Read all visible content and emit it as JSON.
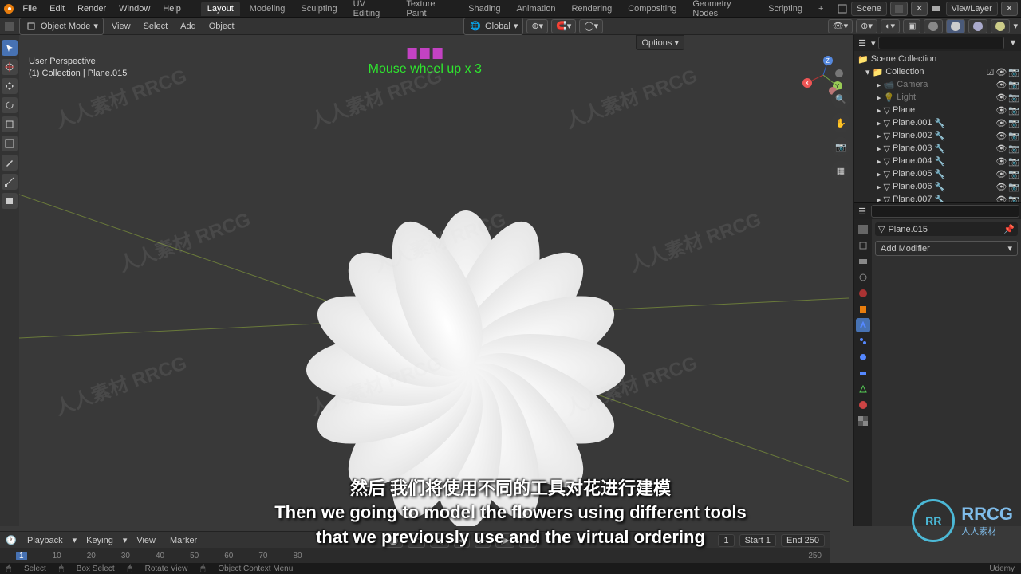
{
  "topbar1": {
    "logo": "blender-icon",
    "menus": [
      "File",
      "Edit",
      "Render",
      "Window",
      "Help"
    ],
    "tabs": [
      "Layout",
      "Modeling",
      "Sculpting",
      "UV Editing",
      "Texture Paint",
      "Shading",
      "Animation",
      "Rendering",
      "Compositing",
      "Geometry Nodes",
      "Scripting"
    ],
    "tab_plus": "+",
    "scene_label": "Scene",
    "viewlayer_label": "ViewLayer"
  },
  "topbar2": {
    "mode": "Object Mode",
    "menus": [
      "View",
      "Select",
      "Add",
      "Object"
    ],
    "orientation": "Global",
    "options_label": "Options"
  },
  "overlay": {
    "line1": "User Perspective",
    "line2": "(1) Collection | Plane.015"
  },
  "hud": {
    "text": "Mouse wheel up x 3"
  },
  "outliner": {
    "root": "Scene Collection",
    "collection": "Collection",
    "items": [
      "Camera",
      "Light",
      "Plane",
      "Plane.001",
      "Plane.002",
      "Plane.003",
      "Plane.004",
      "Plane.005",
      "Plane.006",
      "Plane.007"
    ]
  },
  "props": {
    "active": "Plane.015",
    "add_modifier": "Add Modifier"
  },
  "timeline": {
    "menus": [
      "Playback",
      "Keying",
      "View",
      "Marker"
    ],
    "current": "1",
    "start_lbl": "Start",
    "start_val": "1",
    "end_lbl": "End",
    "end_val": "250",
    "marks": [
      "1",
      "10",
      "20",
      "30",
      "40",
      "50",
      "60",
      "70",
      "80",
      "250"
    ]
  },
  "status": {
    "select": "Select",
    "box": "Box Select",
    "rotate": "Rotate View",
    "ctx": "Object Context Menu"
  },
  "subtitle": {
    "cn": "然后 我们将使用不同的工具对花进行建模",
    "en1": "Then we going to model the flowers using different tools",
    "en2": "that we previously use and the virtual ordering"
  },
  "watermark": "人人素材 RRCG",
  "logo_text": "RRCG",
  "logo_sub": "人人素材",
  "udemy": "Udemy"
}
